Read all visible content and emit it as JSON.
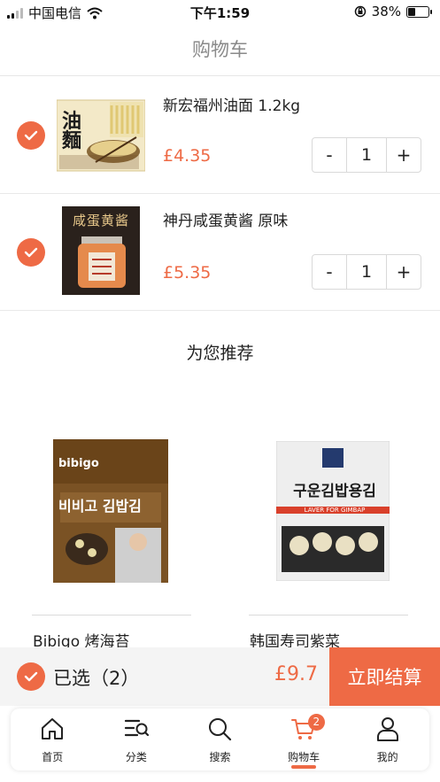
{
  "status_bar": {
    "carrier": "中国电信",
    "time": "下午1:59",
    "battery": "38%",
    "battery_level": 0.38
  },
  "header": {
    "title": "购物车"
  },
  "cart": {
    "items": [
      {
        "name": "新宏福州油面 1.2kg",
        "price": "£4.35",
        "quantity": "1",
        "minus": "-",
        "plus": "+"
      },
      {
        "name": "神丹咸蛋黄酱 原味",
        "price": "£5.35",
        "quantity": "1",
        "minus": "-",
        "plus": "+"
      }
    ]
  },
  "recommend": {
    "title": "为您推荐",
    "items": [
      {
        "name": "Bibigo 烤海苔",
        "image_text_top": "bibigo",
        "image_text_korean": "비비고 김밥김"
      },
      {
        "name": "韩国寿司紫菜",
        "image_text_korean": "구운김밥용김",
        "image_text_sub": "LAVER FOR GIMBAP"
      }
    ]
  },
  "product_images": {
    "noodle": {
      "text": "油麵"
    },
    "sauce": {
      "text": "咸蛋黄酱"
    }
  },
  "checkout": {
    "selected_label": "已选（2）",
    "total": "£9.7",
    "button": "立即结算"
  },
  "tabs": [
    {
      "label": "首页",
      "icon": "home-icon"
    },
    {
      "label": "分类",
      "icon": "category-icon"
    },
    {
      "label": "搜索",
      "icon": "search-icon"
    },
    {
      "label": "购物车",
      "icon": "cart-icon",
      "badge": "2",
      "active": true
    },
    {
      "label": "我的",
      "icon": "user-icon"
    }
  ],
  "colors": {
    "accent": "#ee6a45",
    "muted_title": "#8a8a8a",
    "checkout_bg": "#f4f4f4"
  }
}
